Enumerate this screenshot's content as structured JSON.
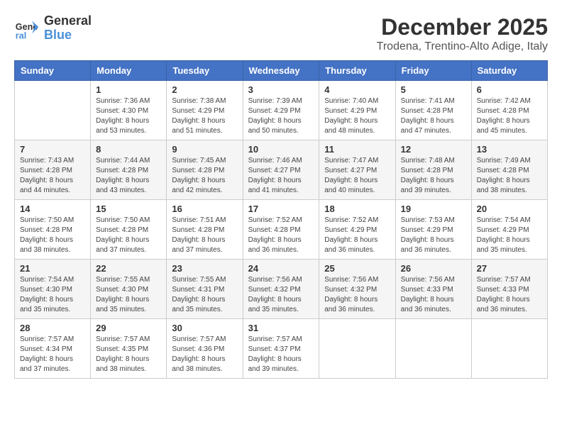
{
  "logo": {
    "line1": "General",
    "line2": "Blue"
  },
  "header": {
    "month_year": "December 2025",
    "location": "Trodena, Trentino-Alto Adige, Italy"
  },
  "weekdays": [
    "Sunday",
    "Monday",
    "Tuesday",
    "Wednesday",
    "Thursday",
    "Friday",
    "Saturday"
  ],
  "weeks": [
    [
      {
        "day": "",
        "info": ""
      },
      {
        "day": "1",
        "info": "Sunrise: 7:36 AM\nSunset: 4:30 PM\nDaylight: 8 hours\nand 53 minutes."
      },
      {
        "day": "2",
        "info": "Sunrise: 7:38 AM\nSunset: 4:29 PM\nDaylight: 8 hours\nand 51 minutes."
      },
      {
        "day": "3",
        "info": "Sunrise: 7:39 AM\nSunset: 4:29 PM\nDaylight: 8 hours\nand 50 minutes."
      },
      {
        "day": "4",
        "info": "Sunrise: 7:40 AM\nSunset: 4:29 PM\nDaylight: 8 hours\nand 48 minutes."
      },
      {
        "day": "5",
        "info": "Sunrise: 7:41 AM\nSunset: 4:28 PM\nDaylight: 8 hours\nand 47 minutes."
      },
      {
        "day": "6",
        "info": "Sunrise: 7:42 AM\nSunset: 4:28 PM\nDaylight: 8 hours\nand 45 minutes."
      }
    ],
    [
      {
        "day": "7",
        "info": "Sunrise: 7:43 AM\nSunset: 4:28 PM\nDaylight: 8 hours\nand 44 minutes."
      },
      {
        "day": "8",
        "info": "Sunrise: 7:44 AM\nSunset: 4:28 PM\nDaylight: 8 hours\nand 43 minutes."
      },
      {
        "day": "9",
        "info": "Sunrise: 7:45 AM\nSunset: 4:28 PM\nDaylight: 8 hours\nand 42 minutes."
      },
      {
        "day": "10",
        "info": "Sunrise: 7:46 AM\nSunset: 4:27 PM\nDaylight: 8 hours\nand 41 minutes."
      },
      {
        "day": "11",
        "info": "Sunrise: 7:47 AM\nSunset: 4:27 PM\nDaylight: 8 hours\nand 40 minutes."
      },
      {
        "day": "12",
        "info": "Sunrise: 7:48 AM\nSunset: 4:28 PM\nDaylight: 8 hours\nand 39 minutes."
      },
      {
        "day": "13",
        "info": "Sunrise: 7:49 AM\nSunset: 4:28 PM\nDaylight: 8 hours\nand 38 minutes."
      }
    ],
    [
      {
        "day": "14",
        "info": "Sunrise: 7:50 AM\nSunset: 4:28 PM\nDaylight: 8 hours\nand 38 minutes."
      },
      {
        "day": "15",
        "info": "Sunrise: 7:50 AM\nSunset: 4:28 PM\nDaylight: 8 hours\nand 37 minutes."
      },
      {
        "day": "16",
        "info": "Sunrise: 7:51 AM\nSunset: 4:28 PM\nDaylight: 8 hours\nand 37 minutes."
      },
      {
        "day": "17",
        "info": "Sunrise: 7:52 AM\nSunset: 4:28 PM\nDaylight: 8 hours\nand 36 minutes."
      },
      {
        "day": "18",
        "info": "Sunrise: 7:52 AM\nSunset: 4:29 PM\nDaylight: 8 hours\nand 36 minutes."
      },
      {
        "day": "19",
        "info": "Sunrise: 7:53 AM\nSunset: 4:29 PM\nDaylight: 8 hours\nand 36 minutes."
      },
      {
        "day": "20",
        "info": "Sunrise: 7:54 AM\nSunset: 4:29 PM\nDaylight: 8 hours\nand 35 minutes."
      }
    ],
    [
      {
        "day": "21",
        "info": "Sunrise: 7:54 AM\nSunset: 4:30 PM\nDaylight: 8 hours\nand 35 minutes."
      },
      {
        "day": "22",
        "info": "Sunrise: 7:55 AM\nSunset: 4:30 PM\nDaylight: 8 hours\nand 35 minutes."
      },
      {
        "day": "23",
        "info": "Sunrise: 7:55 AM\nSunset: 4:31 PM\nDaylight: 8 hours\nand 35 minutes."
      },
      {
        "day": "24",
        "info": "Sunrise: 7:56 AM\nSunset: 4:32 PM\nDaylight: 8 hours\nand 35 minutes."
      },
      {
        "day": "25",
        "info": "Sunrise: 7:56 AM\nSunset: 4:32 PM\nDaylight: 8 hours\nand 36 minutes."
      },
      {
        "day": "26",
        "info": "Sunrise: 7:56 AM\nSunset: 4:33 PM\nDaylight: 8 hours\nand 36 minutes."
      },
      {
        "day": "27",
        "info": "Sunrise: 7:57 AM\nSunset: 4:33 PM\nDaylight: 8 hours\nand 36 minutes."
      }
    ],
    [
      {
        "day": "28",
        "info": "Sunrise: 7:57 AM\nSunset: 4:34 PM\nDaylight: 8 hours\nand 37 minutes."
      },
      {
        "day": "29",
        "info": "Sunrise: 7:57 AM\nSunset: 4:35 PM\nDaylight: 8 hours\nand 38 minutes."
      },
      {
        "day": "30",
        "info": "Sunrise: 7:57 AM\nSunset: 4:36 PM\nDaylight: 8 hours\nand 38 minutes."
      },
      {
        "day": "31",
        "info": "Sunrise: 7:57 AM\nSunset: 4:37 PM\nDaylight: 8 hours\nand 39 minutes."
      },
      {
        "day": "",
        "info": ""
      },
      {
        "day": "",
        "info": ""
      },
      {
        "day": "",
        "info": ""
      }
    ]
  ]
}
